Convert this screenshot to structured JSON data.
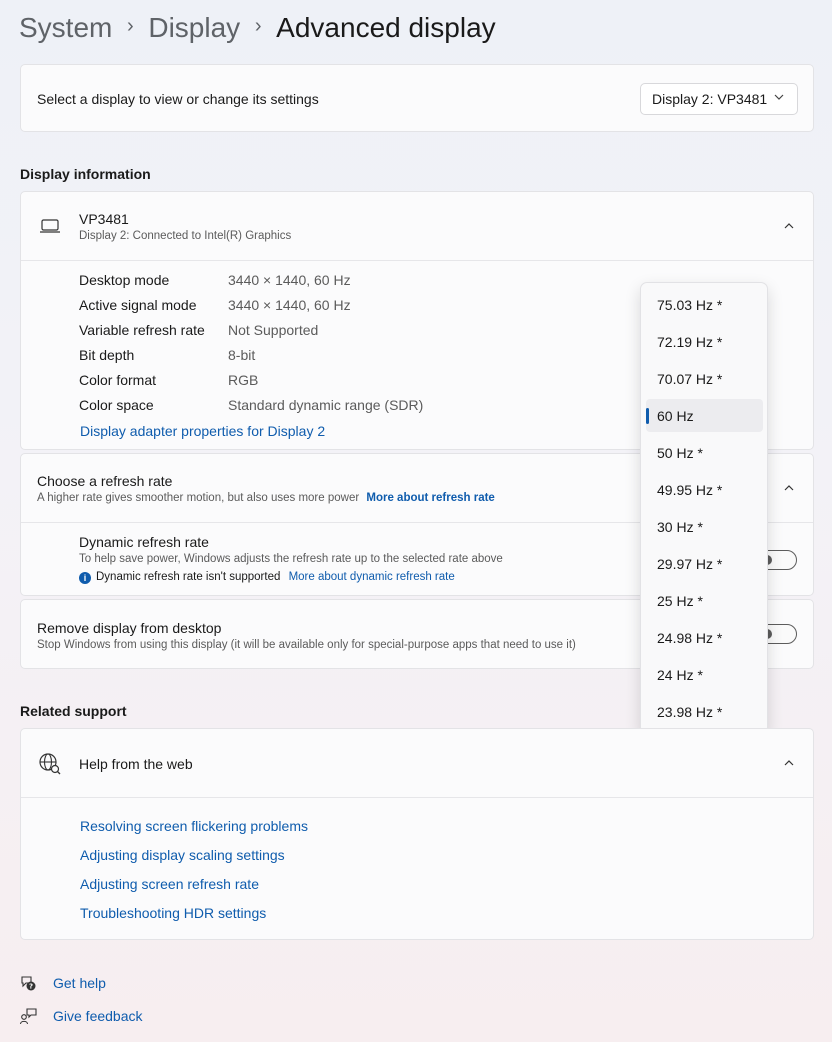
{
  "breadcrumb": {
    "items": [
      "System",
      "Display"
    ],
    "current": "Advanced display",
    "separator": "›"
  },
  "display_select": {
    "label": "Select a display to view or change its settings",
    "value": "Display 2: VP3481"
  },
  "display_info": {
    "section_title": "Display information",
    "name": "VP3481",
    "subtitle": "Display 2: Connected to Intel(R) Graphics",
    "rows": [
      {
        "key": "Desktop mode",
        "value": "3440 × 1440, 60 Hz"
      },
      {
        "key": "Active signal mode",
        "value": "3440 × 1440, 60 Hz"
      },
      {
        "key": "Variable refresh rate",
        "value": "Not Supported"
      },
      {
        "key": "Bit depth",
        "value": "8-bit"
      },
      {
        "key": "Color format",
        "value": "RGB"
      },
      {
        "key": "Color space",
        "value": "Standard dynamic range (SDR)"
      }
    ],
    "adapter_link": "Display adapter properties for Display 2"
  },
  "refresh_rate": {
    "title": "Choose a refresh rate",
    "description": "A higher rate gives smoother motion, but also uses more power",
    "more_link": "More about refresh rate",
    "dynamic_title": "Dynamic refresh rate",
    "dynamic_description": "To help save power, Windows adjusts the refresh rate up to the selected rate above",
    "dynamic_note": "Dynamic refresh rate isn't supported",
    "dynamic_link": "More about dynamic refresh rate",
    "dynamic_toggle": "off"
  },
  "remove_display": {
    "title": "Remove display from desktop",
    "description": "Stop Windows from using this display (it will be available only for special-purpose apps that need to use it)",
    "toggle": "off"
  },
  "refresh_menu": {
    "options": [
      "75.03 Hz *",
      "72.19 Hz *",
      "70.07 Hz *",
      "60 Hz",
      "50 Hz *",
      "49.95 Hz *",
      "30 Hz *",
      "29.97 Hz *",
      "25 Hz *",
      "24.98 Hz *",
      "24 Hz *",
      "23.98 Hz *"
    ],
    "selected": "60 Hz"
  },
  "related_support": {
    "section_title": "Related support",
    "help_title": "Help from the web",
    "links": [
      "Resolving screen flickering problems",
      "Adjusting display scaling settings",
      "Adjusting screen refresh rate",
      "Troubleshooting HDR settings"
    ]
  },
  "footer": {
    "get_help": "Get help",
    "give_feedback": "Give feedback"
  },
  "icons": {
    "chevron_down": "chevron-down-icon",
    "chevron_up": "chevron-up-icon",
    "laptop": "laptop-icon",
    "globe": "globe-icon",
    "info": "info-icon",
    "help": "help-icon",
    "feedback": "feedback-icon"
  },
  "colors": {
    "accent": "#0f5cad",
    "link": "#0f5cad"
  }
}
